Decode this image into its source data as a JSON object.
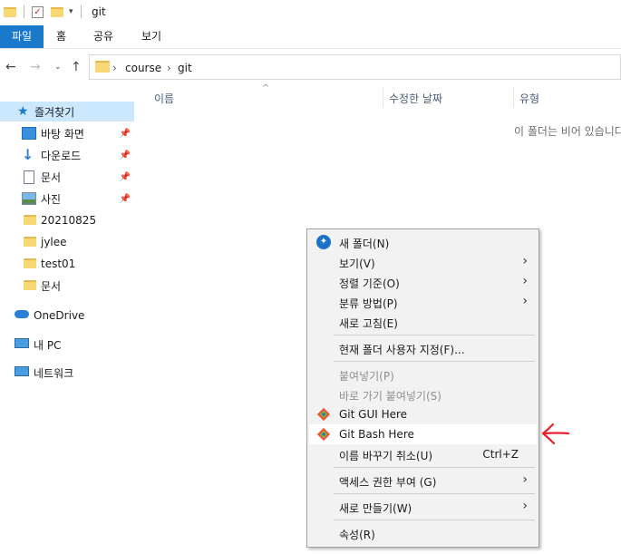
{
  "window": {
    "title": "git"
  },
  "ribbon": {
    "tabs": [
      "파일",
      "홈",
      "공유",
      "보기"
    ]
  },
  "address": {
    "crumbs": [
      "course",
      "git"
    ]
  },
  "sidebar": {
    "quick_access": "즐겨찾기",
    "items": [
      "바탕 화면",
      "다운로드",
      "문서",
      "사진",
      "20210825",
      "jylee",
      "test01",
      "문서"
    ],
    "onedrive": "OneDrive",
    "pc": "내 PC",
    "network": "네트워크"
  },
  "columns": {
    "name": "이름",
    "modified": "수정한 날짜",
    "type": "유형"
  },
  "empty_message": "이 폴더는 비어 있습니다.",
  "context_menu": {
    "new_folder": "새 폴더(N)",
    "view": "보기(V)",
    "sort": "정렬 기준(O)",
    "group": "분류 방법(P)",
    "refresh": "새로 고침(E)",
    "customize": "현재 폴더 사용자 지정(F)...",
    "paste": "붙여넣기(P)",
    "paste_shortcut": "바로 가기 붙여넣기(S)",
    "git_gui": "Git GUI Here",
    "git_bash": "Git Bash Here",
    "undo_rename": "이름 바꾸기 취소(U)",
    "undo_shortcut": "Ctrl+Z",
    "access": "액세스 권한 부여 (G)",
    "new": "새로 만들기(W)",
    "properties": "속성(R)"
  },
  "colors": {
    "accent": "#1979ca",
    "selection": "#cce8ff",
    "annotation": "#e8202a"
  }
}
